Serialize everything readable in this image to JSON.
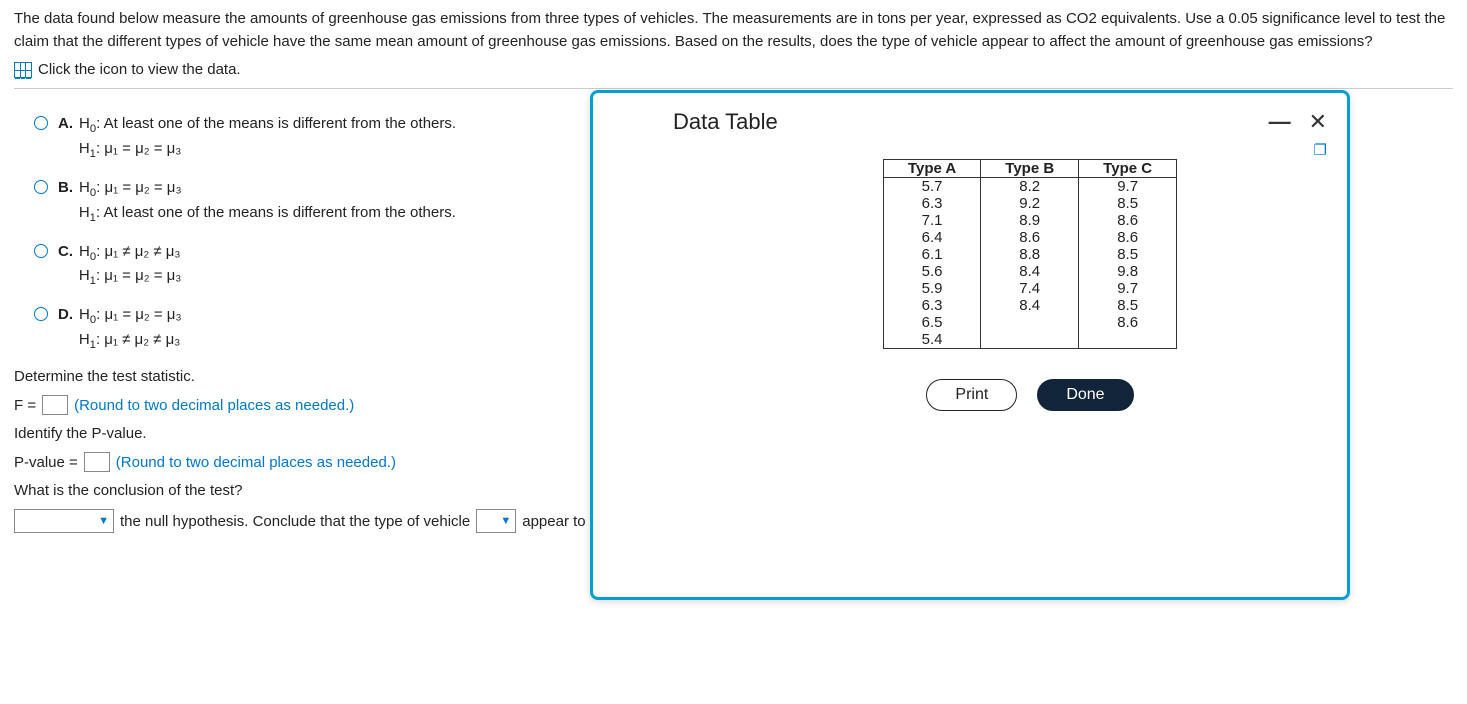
{
  "problem": "The data found below measure the amounts of greenhouse gas emissions from three types of vehicles. The measurements are in tons per year, expressed as CO2 equivalents. Use a 0.05 significance level to test the claim that the different types of vehicle have the same mean amount of greenhouse gas emissions. Based on the results, does the type of vehicle appear to affect the amount of greenhouse gas emissions?",
  "iconLink": "Click the icon to view the data.",
  "options": {
    "A": {
      "h0": "At least one of the means is different from the others.",
      "h1": "μ₁ = μ₂ = μ₃"
    },
    "B": {
      "h0": "μ₁ = μ₂ = μ₃",
      "h1": "At least one of the means is different from the others."
    },
    "C": {
      "h0": "μ₁ ≠ μ₂ ≠ μ₃",
      "h1": "μ₁ = μ₂ = μ₃"
    },
    "D": {
      "h0": "μ₁ = μ₂ = μ₃",
      "h1": "μ₁ ≠ μ₂ ≠ μ₃"
    }
  },
  "q": {
    "determine": "Determine the test statistic.",
    "fLabel": "F =",
    "roundHint": "(Round to two decimal places as needed.)",
    "identifyP": "Identify the P-value.",
    "pLabel": "P-value =",
    "conclQ": "What is the conclusion of the test?",
    "concl1": "the null hypothesis. Conclude that the type of vehicle",
    "concl2": "appear to affect the amount of greenhouse gas emissions for these three types."
  },
  "modal": {
    "title": "Data Table",
    "print": "Print",
    "done": "Done",
    "headers": [
      "Type A",
      "Type B",
      "Type C"
    ],
    "rows": [
      [
        "5.7",
        "8.2",
        "9.7"
      ],
      [
        "6.3",
        "9.2",
        "8.5"
      ],
      [
        "7.1",
        "8.9",
        "8.6"
      ],
      [
        "6.4",
        "8.6",
        "8.6"
      ],
      [
        "6.1",
        "8.8",
        "8.5"
      ],
      [
        "5.6",
        "8.4",
        "9.8"
      ],
      [
        "5.9",
        "7.4",
        "9.7"
      ],
      [
        "6.3",
        "8.4",
        "8.5"
      ],
      [
        "6.5",
        "",
        "8.6"
      ],
      [
        "5.4",
        "",
        ""
      ]
    ]
  }
}
